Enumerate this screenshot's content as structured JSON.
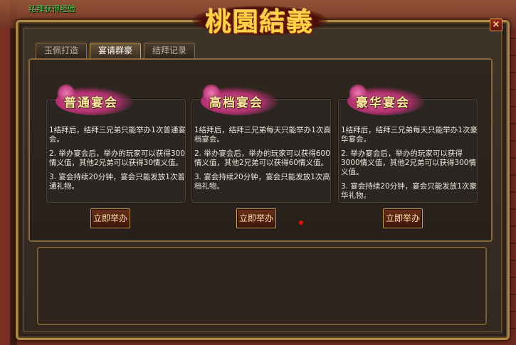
{
  "player_status": {
    "line1": "",
    "line2": "结拜获得经验"
  },
  "dialog": {
    "title": "桃園結義",
    "close_label": "×"
  },
  "tabs": [
    {
      "label": "玉佩打造",
      "active": false
    },
    {
      "label": "宴请群豪",
      "active": true
    },
    {
      "label": "结拜记录",
      "active": false
    }
  ],
  "cards": [
    {
      "title": "普通宴会",
      "rules": [
        "1结拜后，结拜三兄弟只能举办1次普通宴会。",
        "2. 举办宴会后，举办的玩家可以获得300情义值，其他2兄弟可以获得30情义值。",
        "3. 宴会持续20分钟，宴会只能发放1次普通礼物。"
      ],
      "button_label": "立即举办"
    },
    {
      "title": "高档宴会",
      "rules": [
        "1结拜后，结拜三兄弟每天只能举办1次高档宴会。",
        "2. 举办宴会后，举办的玩家可以获得600情义值，其他2兄弟可以获得60情义值。",
        "3. 宴会持续20分钟，宴会只能发放1次高档礼物。"
      ],
      "button_label": "立即举办"
    },
    {
      "title": "豪华宴会",
      "rules": [
        "1结拜后，结拜三兄弟每天只能举办1次豪华宴会。",
        "2. 举办宴会后，举办的玩家可以获得3000情义值，其他2兄弟可以获得300情义值。",
        "3. 宴会持续20分钟，宴会只能发放1次豪华礼物。"
      ],
      "button_label": "立即举办"
    }
  ],
  "colors": {
    "frame_gold": "#b08a45",
    "title_gold": "#ffd24a",
    "card_title": "#ffe8a8",
    "card_blob_pink": "#e05c9c",
    "status_green": "#39d24a",
    "alert_dot": "#e01010"
  }
}
